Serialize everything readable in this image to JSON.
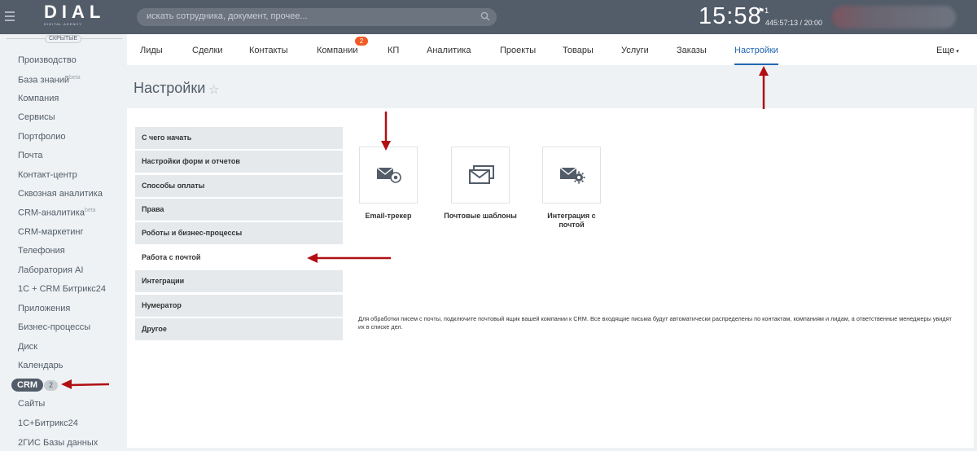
{
  "header": {
    "logo_text": "DIAL",
    "logo_sub": "DIGITAL AGENCY",
    "search_placeholder": "искать сотрудника, документ, прочее...",
    "clock": "15:58",
    "flag_count": "1",
    "timer": "445:57:13 / 20:00"
  },
  "leftmenu": {
    "hidden_label": "СКРЫТЫЕ",
    "items": [
      {
        "label": "Производство"
      },
      {
        "label": "База знаний",
        "sup": "beta"
      },
      {
        "label": "Компания"
      },
      {
        "label": "Сервисы"
      },
      {
        "label": "Портфолио"
      },
      {
        "label": "Почта"
      },
      {
        "label": "Контакт-центр"
      },
      {
        "label": "Сквозная аналитика"
      },
      {
        "label": "CRM-аналитика",
        "sup": "beta"
      },
      {
        "label": "CRM-маркетинг"
      },
      {
        "label": "Телефония"
      },
      {
        "label": "Лаборатория AI"
      },
      {
        "label": "1С + CRM Битрикс24"
      },
      {
        "label": "Приложения"
      },
      {
        "label": "Бизнес-процессы"
      },
      {
        "label": "Диск"
      },
      {
        "label": "Календарь"
      }
    ],
    "crm_label": "CRM",
    "crm_count": "2",
    "after_items": [
      {
        "label": "Сайты"
      },
      {
        "label": "1С+Битрикс24"
      },
      {
        "label": "2ГИС Базы данных"
      }
    ]
  },
  "tabs": {
    "items": [
      "Лиды",
      "Сделки",
      "Контакты",
      "Компании",
      "КП",
      "Аналитика",
      "Проекты",
      "Товары",
      "Услуги",
      "Заказы",
      "Настройки"
    ],
    "companies_badge": "2",
    "more": "Еще"
  },
  "page": {
    "title": "Настройки"
  },
  "settings_menu": {
    "items": [
      "С чего начать",
      "Настройки форм и отчетов",
      "Способы оплаты",
      "Права",
      "Роботы и бизнес-процессы",
      "Работа с почтой",
      "Интеграции",
      "Нумератор",
      "Другое"
    ]
  },
  "tiles": {
    "items": [
      {
        "label": "Email-трекер",
        "icon": "email-tracker-icon"
      },
      {
        "label": "Почтовые шаблоны",
        "icon": "mail-templates-icon"
      },
      {
        "label": "Интеграция с почтой",
        "icon": "mail-integration-icon"
      }
    ]
  },
  "note": {
    "text": "Для обработки писем с почты, подключите почтовый ящик вашей компании к CRM. Все входящие письма будут автоматически распределены по контактам, компаниям и лидам, а ответственные менеджеры увидят их в списке дел."
  },
  "colors": {
    "header_bg": "#535c69",
    "active_tab": "#2067b0",
    "badge": "#f25a24",
    "arrow": "#b10f12"
  }
}
